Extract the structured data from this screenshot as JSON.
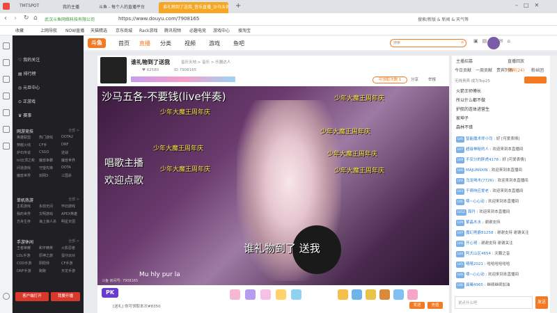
{
  "browser": {
    "tabs": [
      "TMTSPOT",
      "我的主播",
      "斗鱼 - 每个人的直播平台",
      "谁礼物到了送我_音乐直播_沙马五各_斗鱼直播"
    ],
    "url": "https://www.douyu.com/7908165",
    "company": "武汉斗鱼网络科技有限公司",
    "top_right": "搜索/新版 & 新闻 & 天气等",
    "bookmarks": [
      "收藏",
      "上网导航",
      "NOW直播",
      "天猫精选",
      "京东商城",
      "Rack游戏",
      "腾讯视频",
      "必趣电竞",
      "游戏中心",
      "搜淘宝"
    ]
  },
  "header": {
    "logo": "斗鱼",
    "nav": [
      "首页",
      "直播",
      "分类",
      "视频",
      "游戏",
      "鱼吧"
    ],
    "search_placeholder": "搜索"
  },
  "sidebar": {
    "main": [
      "我的关注",
      "排行榜",
      "元旦中心",
      "正游戏",
      "赛事"
    ],
    "sections": [
      {
        "title": "网游竞技",
        "more": "全部 >",
        "items": [
          "英雄联盟",
          "热门游戏",
          "DOTA2",
          "穿越火线",
          "CF手",
          "DNF",
          "炉石传说",
          "CSGO",
          "逆战",
          "lol云顶之奕",
          "魔兽争霸",
          "魔兽世界",
          "问道游戏",
          "守望先锋",
          "DOTA",
          "魔兽世界",
          "剑网3",
          "三国杀"
        ]
      },
      {
        "title": "单机热游",
        "more": "全部 >",
        "items": [
          "主机游戏",
          "永劫无间",
          "怀旧游戏",
          "我的世界",
          "文明游戏",
          "APEX英雄",
          "方舟生存",
          "海上狼人杀",
          "明星天团"
        ]
      },
      {
        "title": "手游休闲",
        "more": "全部 >",
        "items": [
          "王者荣耀",
          "和平精英",
          "火影忍者",
          "LOL手游",
          "原神之旅",
          "蛋仔派对",
          "COD手游",
          "阴阳师",
          "CF手游",
          "DNF手游",
          "跑跑",
          "天龙手游"
        ]
      }
    ],
    "buttons": [
      "客户端打开",
      "我要开播"
    ]
  },
  "stream": {
    "title": "谁礼物到了送我",
    "category": "音乐天地 > 音乐 > 乐器达人",
    "id": "7908165",
    "fans": "62580",
    "hot_label": "可领取次数",
    "hot_value": "1",
    "share": "分享",
    "report": "举报",
    "follow": "关注",
    "overlay": {
      "top": "沙马五各-不要钱(live伴奏)",
      "repeat": "少年大魔王周年庆",
      "left1": "唱歌主播",
      "left2": "欢迎点歌",
      "bottom": "谁礼物到了 送我",
      "sub": "Mu hly pur la",
      "room": "斗鱼 房间号: 7908165"
    }
  },
  "bottombar": {
    "pk": "PK",
    "msg": "[送礼] 你可领取本次#8350",
    "send_btn": "发送",
    "recharge": "充值"
  },
  "right": {
    "top_tabs": [
      "主播招募",
      "直播回放"
    ],
    "tabs": [
      "今日贡献",
      "一周贡献",
      "贵宾列表",
      "贵宾(24)",
      "粉丝团"
    ],
    "rank_header": "无线贵宾·成为Top25",
    "ranks": [
      "火箭王师傅长",
      "所以什么都不做",
      "护航的连体进营生",
      "家坤子",
      "森林不错"
    ],
    "chats": [
      {
        "lv": "LV6",
        "user": "智能魔术师小司",
        "text": "好 [可爱表情]"
      },
      {
        "lv": "LV7",
        "user": "超级神秘的人",
        "text": "欢迎来到本直播间"
      },
      {
        "lv": "LV9",
        "user": "不安分的胖虎4178",
        "text": "好 [可爱表情]"
      },
      {
        "lv": "LV6",
        "user": "MAJUANXIN",
        "text": "欢迎来到本直播间"
      },
      {
        "lv": "LV6",
        "user": "乌龙喝木(7726)",
        "text": "欢迎来到本直播间"
      },
      {
        "lv": "LV3",
        "user": "千萌响应爱老",
        "text": "欢迎来到本直播间"
      },
      {
        "lv": "LV6",
        "user": "喂~心心动",
        "text": "欢迎来到本直播间"
      },
      {
        "lv": "LV12",
        "user": "周丹",
        "text": "欢迎来到本直播间"
      },
      {
        "lv": "LV9",
        "user": "紫晶木水",
        "text": "谢谢支持"
      },
      {
        "lv": "LV7",
        "user": "魔幻男爵81258",
        "text": "谢谢支持 谢谢关注"
      },
      {
        "lv": "LV6",
        "user": "开心哥",
        "text": "谢谢支持 谢谢关注"
      },
      {
        "lv": "LV4",
        "user": "阿大山区4654",
        "text": "天籁之音"
      },
      {
        "lv": "LV5",
        "user": "嘻嘻2021",
        "text": "哈哈哈哈哈哈"
      },
      {
        "lv": "LV6",
        "user": "喂~心心动",
        "text": "欢迎来到本直播间"
      },
      {
        "lv": "LV6",
        "user": "晨曦4965",
        "text": "继续继续加油"
      }
    ],
    "input_placeholder": "说点什么吧",
    "send": "发送"
  },
  "colors": {
    "accent": "#f47920",
    "sidebar": "#1f1f24",
    "overlay_text": "#f6e43c"
  }
}
